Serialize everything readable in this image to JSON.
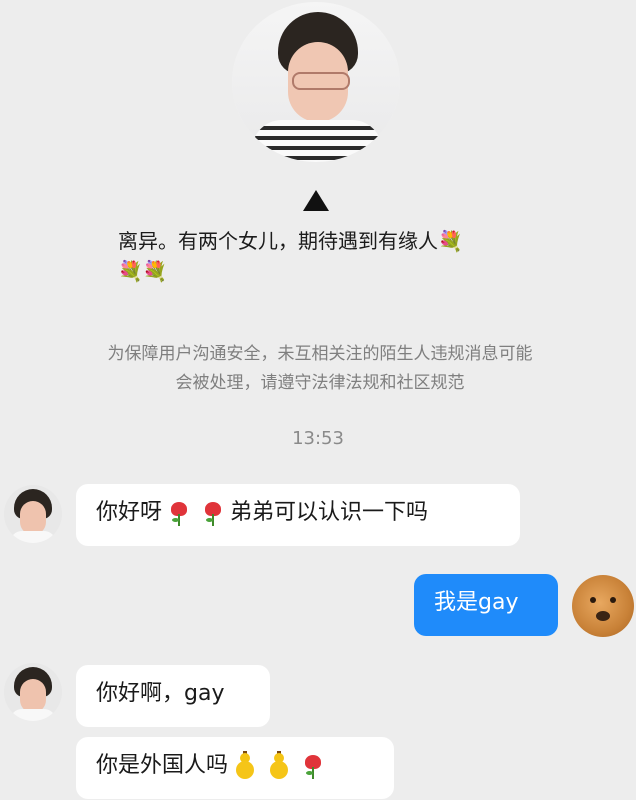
{
  "profile": {
    "bio_text": "离异。有两个女儿，期待遇到有缘人",
    "bio_emoji_1": "💐",
    "bio_emoji_line2": "💐💐"
  },
  "notice": {
    "line1": "为保障用户沟通安全，未互相关注的陌生人违规消息可能",
    "line2": "会被处理，请遵守法律法规和社区规范"
  },
  "timestamp": "13:53",
  "messages": [
    {
      "sender": "other",
      "part1": "你好呀",
      "part2": "弟弟可以认识一下吗"
    },
    {
      "sender": "me",
      "text": "我是gay"
    },
    {
      "sender": "other",
      "text": "你好啊，gay"
    },
    {
      "sender": "other",
      "text": "你是外国人吗"
    }
  ],
  "colors": {
    "background": "#ededed",
    "my_bubble": "#1f8bfa",
    "other_bubble": "#ffffff",
    "notice_text": "#7f7f7f"
  },
  "icons": [
    "triangle-icon",
    "rose-icon",
    "gourd-icon",
    "bouquet-icon"
  ]
}
